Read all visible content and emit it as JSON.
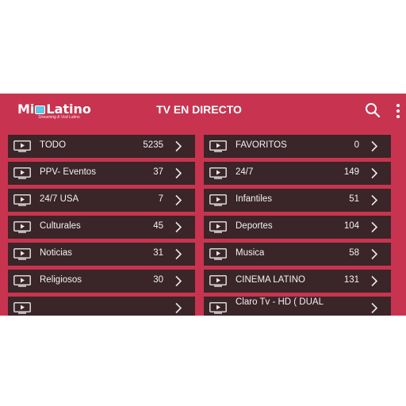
{
  "header": {
    "logo_text_left": "Mi",
    "logo_text_right": "Latino",
    "logo_tagline": "Streaming & Vod Latino",
    "title": "TV EN DIRECTO"
  },
  "icons": {
    "search": "search-icon",
    "menu": "more-vert-icon",
    "category": "tv-icon",
    "arrow": "chevron-right-icon"
  },
  "colors": {
    "background": "#c8344f",
    "row": "#3a2529",
    "logo_tv": "#5ec9e6"
  },
  "left_categories": [
    {
      "label": "TODO",
      "count": "5235"
    },
    {
      "label": "PPV- Eventos",
      "count": "37"
    },
    {
      "label": "24/7 USA",
      "count": "7"
    },
    {
      "label": "Culturales",
      "count": "45"
    },
    {
      "label": "Noticias",
      "count": "31"
    },
    {
      "label": "Religiosos",
      "count": "30"
    },
    {
      "label": "",
      "count": ""
    }
  ],
  "right_categories": [
    {
      "label": "FAVORITOS",
      "count": "0"
    },
    {
      "label": "24/7",
      "count": "149"
    },
    {
      "label": "Infantiles",
      "count": "51"
    },
    {
      "label": "Deportes",
      "count": "104"
    },
    {
      "label": "Musica",
      "count": "58"
    },
    {
      "label": "CINEMA LATINO",
      "count": "131"
    },
    {
      "label": "Claro Tv - HD ( DUAL",
      "count": ""
    }
  ]
}
